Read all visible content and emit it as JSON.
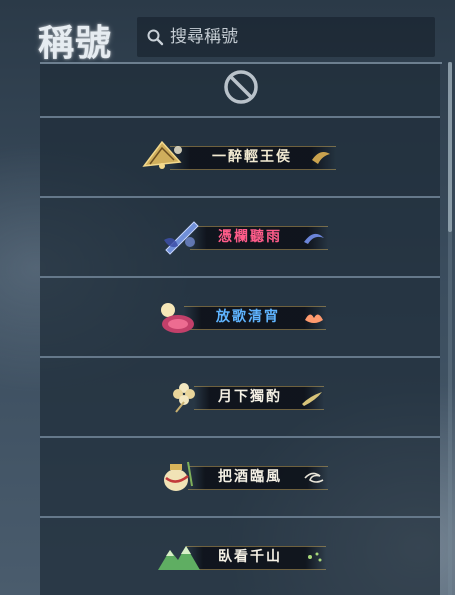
{
  "header": {
    "title": "稱號",
    "search": {
      "placeholder": "搜尋稱號",
      "value": "",
      "icon": "search-icon"
    }
  },
  "titles": {
    "none_option_icon": "no-title-icon",
    "items": [
      {
        "label": "一醉輕王侯",
        "color": "#f2ead2",
        "emblem": "fan-icon"
      },
      {
        "label": "憑欄聽雨",
        "color": "#ff5c8a",
        "emblem": "sword-icon"
      },
      {
        "label": "放歌清宵",
        "color": "#5fb4ff",
        "emblem": "lantern-icon"
      },
      {
        "label": "月下獨酌",
        "color": "#f4f0e4",
        "emblem": "flower-icon"
      },
      {
        "label": "把酒臨風",
        "color": "#f4f0e4",
        "emblem": "wine-jar-icon"
      },
      {
        "label": "臥看千山",
        "color": "#f4f0e4",
        "emblem": "mountain-icon"
      }
    ]
  }
}
